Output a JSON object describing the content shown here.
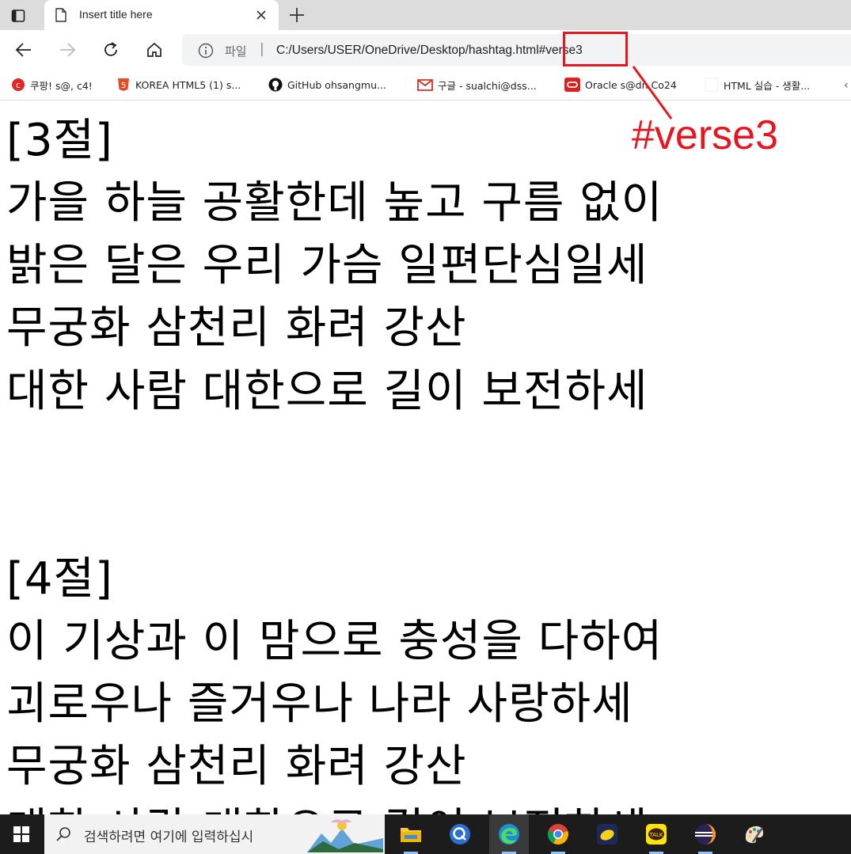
{
  "browser": {
    "tab": {
      "title": "Insert title here"
    },
    "address": {
      "scheme_label": "파일",
      "separator": "|",
      "url": "C:/Users/USER/OneDrive/Desktop/hashtag.html#verse3"
    },
    "bookmarks": [
      {
        "label": "쿠팡! s@, c4!",
        "icon": "coupang-icon"
      },
      {
        "label": "KOREA HTML5 (1) s...",
        "icon": "html5-icon"
      },
      {
        "label": "GitHub  ohsangmu...",
        "icon": "github-icon"
      },
      {
        "label": "구글 - sualchi@dss...",
        "icon": "gmail-icon"
      },
      {
        "label": "Oracle  s@dn Co24",
        "icon": "oracle-icon"
      },
      {
        "label": "HTML 실습 - 생활...",
        "icon": "blank-page-icon"
      }
    ]
  },
  "annotation": {
    "text": "#verse3",
    "color": "#e8151e"
  },
  "page": {
    "verse3": {
      "heading": "[3절]",
      "lines": [
        "가을 하늘 공활한데 높고 구름 없이",
        "밝은 달은 우리 가슴 일편단심일세",
        "무궁화 삼천리 화려 강산",
        "대한 사람 대한으로 길이 보전하세"
      ]
    },
    "verse4": {
      "heading": "[4절]",
      "lines": [
        "이 기상과 이 맘으로 충성을 다하여",
        "괴로우나 즐거우나 나라 사랑하세",
        "무궁화 삼천리 화려 강산",
        "대한 사람 대한으로 길이 보전하세"
      ]
    }
  },
  "taskbar": {
    "search_placeholder": "검색하려면 여기에 입력하십시",
    "apps": [
      "file-explorer-icon",
      "q-app-icon",
      "edge-icon",
      "chrome-icon",
      "lemon-app-icon",
      "kakaotalk-icon",
      "eclipse-icon",
      "paint-icon"
    ],
    "kakaotalk_label": "TALK"
  }
}
